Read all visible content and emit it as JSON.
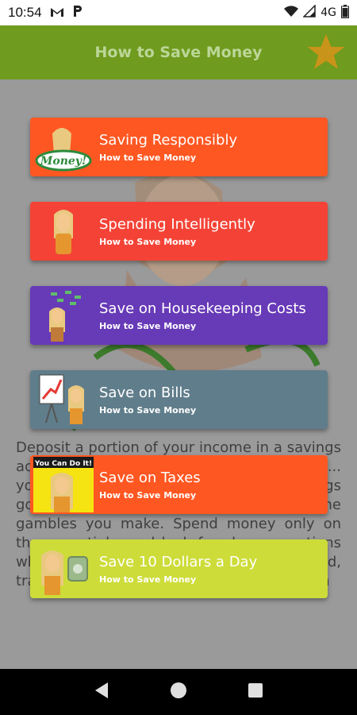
{
  "status_bar": {
    "time": "10:54",
    "left_icons": [
      "gmail-icon",
      "paypal-icon"
    ],
    "network": "4G",
    "right_icons": [
      "wifi-icon",
      "signal-icon",
      "battery-icon"
    ]
  },
  "app_bar": {
    "title": "How to Save Money",
    "action_icon": "star-icon",
    "accent": "#6f9b1e"
  },
  "background_text": "Deposit a portion of your income in a savings account ... you don't automatically ... any ... you ... a realistic timeframe for your savings goals. Cr... ... your ex... ... only if ... the gambles you make. Spend money only on the essentials, and look for cheaper options where available, from housing to food, transportation or energy usage. Save for an",
  "cards": [
    {
      "title": "Saving Responsibly",
      "subtitle": "How to Save Money",
      "color": "#ff5722",
      "thumb_label": "Money!"
    },
    {
      "title": "Spending Intelligently",
      "subtitle": "How to Save Money",
      "color": "#f44336",
      "thumb_label": ""
    },
    {
      "title": "Save on Housekeeping Costs",
      "subtitle": "How to Save Money",
      "color": "#673ab7",
      "thumb_label": ""
    },
    {
      "title": "Save on Bills",
      "subtitle": "How to Save Money",
      "color": "#607d8b",
      "thumb_label": ""
    },
    {
      "title": "Save on Taxes",
      "subtitle": "How to Save Money",
      "color": "#ff5722",
      "thumb_label": "You Can Do It!"
    },
    {
      "title": "Save 10 Dollars a Day",
      "subtitle": "How to Save Money",
      "color": "#cddc39",
      "thumb_label": ""
    }
  ],
  "nav_bar": {
    "buttons": [
      "back-icon",
      "home-icon",
      "recents-icon"
    ]
  }
}
